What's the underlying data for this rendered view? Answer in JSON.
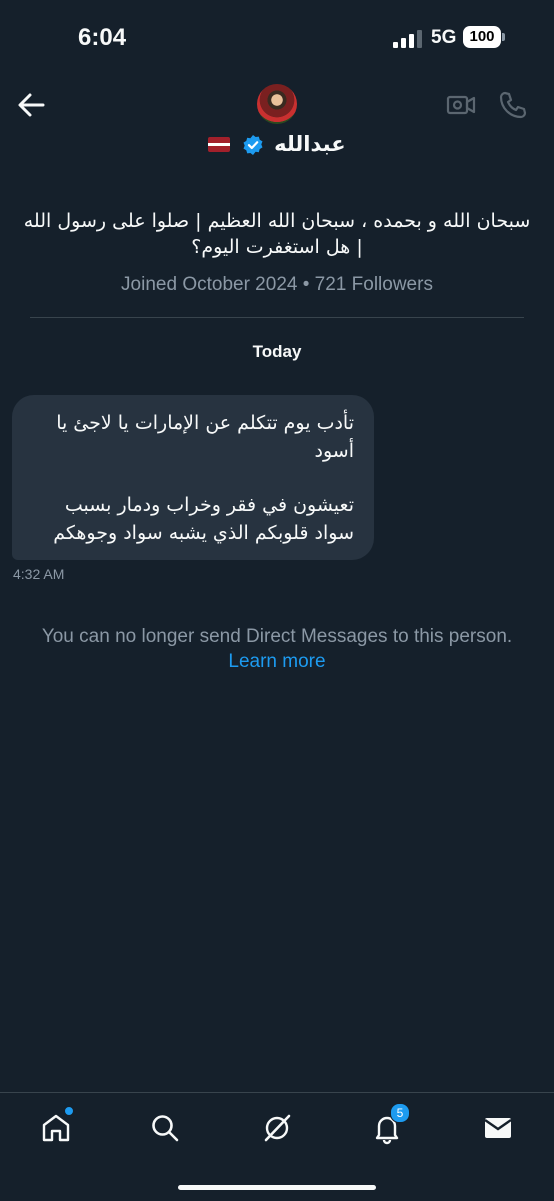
{
  "status_bar": {
    "time": "6:04",
    "network": "5G",
    "battery": "100"
  },
  "header": {
    "display_name": "عبدالله",
    "flag": "latvia-flag-icon",
    "verified": true
  },
  "profile": {
    "bio": "سبحان الله و بحمده ، سبحان الله العظيم | صلوا على رسول الله | هل استغفرت اليوم؟",
    "joined": "Joined October 2024",
    "separator": "•",
    "followers": "721 Followers"
  },
  "conversation": {
    "day_label": "Today",
    "messages": [
      {
        "paragraph_1": "تأدب يوم تتكلم عن الإمارات يا لاجئ يا أسود",
        "paragraph_2": "تعيشون في فقر وخراب ودمار بسبب سواد قلوبكم الذي يشبه سواد وجوهكم",
        "time": "4:32 AM"
      }
    ],
    "notice": "You can no longer send Direct Messages to this person.",
    "learn_more": "Learn more"
  },
  "tab_bar": {
    "items": [
      "home-icon",
      "search-icon",
      "grok-icon",
      "notifications-icon",
      "messages-icon"
    ],
    "notifications_badge": "5"
  },
  "colors": {
    "background": "#15202b",
    "bubble": "#273340",
    "accent": "#1d9bf0",
    "muted": "#8b98a5"
  }
}
